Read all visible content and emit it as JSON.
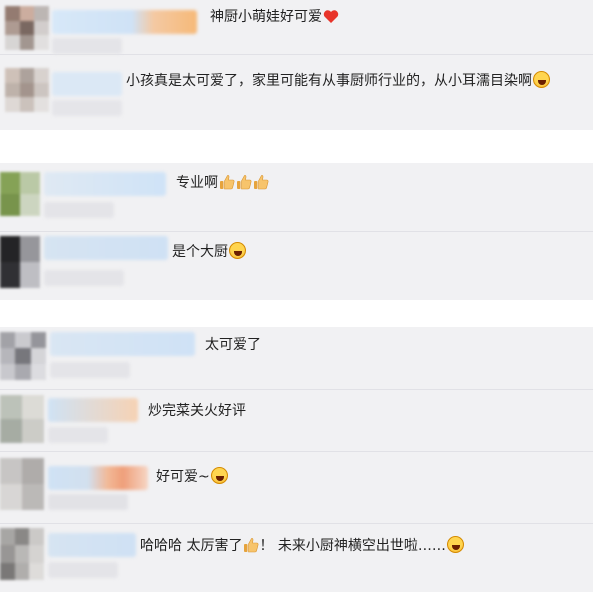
{
  "comments": [
    {
      "text": "神厨小萌娃好可爱",
      "emoji": "heart-icon"
    },
    {
      "text": "小孩真是太可爱了，家里可能有从事厨师行业的，从小耳濡目染啊",
      "emoji": "laugh-icon"
    },
    {
      "text": "专业啊",
      "emoji": "thumbs-up-icon x3"
    },
    {
      "text": "是个大厨",
      "emoji": "laugh-icon"
    },
    {
      "text": "太可爱了",
      "emoji": ""
    },
    {
      "text": "炒完菜关火好评",
      "emoji": ""
    },
    {
      "text": "好可爱~",
      "emoji": "laugh-icon"
    },
    {
      "text_a": "哈哈哈 太厉害了",
      "text_b": "！ 未来小厨神横空出世啦……",
      "emoji": "thumbs-up-icon, laugh-icon"
    }
  ],
  "colors": {
    "accent_heart": "#e8342a",
    "thumb": "#f5b041",
    "blur_blue": "#cfe4f7",
    "blur_orange": "#f7c28b"
  }
}
